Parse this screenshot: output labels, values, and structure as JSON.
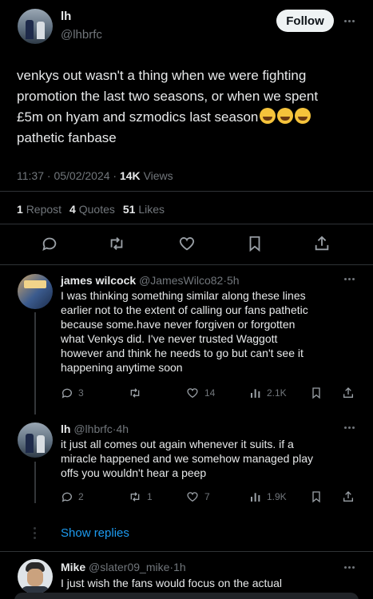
{
  "main_tweet": {
    "display_name": "lh",
    "handle": "@lhbrfc",
    "follow_label": "Follow",
    "text_line1": "venkys out wasn't a thing when we were fighting",
    "text_line2": "promotion the last two seasons, or when we spent",
    "text_line3": "£5m on hyam and szmodics last season",
    "text_line4": "pathetic fanbase",
    "time": "11:37",
    "date": "05/02/2024",
    "views_count": "14K",
    "views_label": "Views",
    "reposts_count": "1",
    "reposts_label": "Repost",
    "quotes_count": "4",
    "quotes_label": "Quotes",
    "likes_count": "51",
    "likes_label": "Likes"
  },
  "replies": [
    {
      "display_name": "james wilcock",
      "handle": "@JamesWilco82",
      "age": "5h",
      "lines": [
        "I was thinking something similar along these lines",
        "earlier not to the extent of calling our fans pathetic",
        "because some.have never forgiven or forgotten",
        "what Venkys did. I've never trusted Waggott",
        "however and think he needs to go but can't see it",
        "happening anytime soon"
      ],
      "replies": "3",
      "reposts": "",
      "likes": "14",
      "views": "2.1K"
    },
    {
      "display_name": "lh",
      "handle": "@lhbrfc",
      "age": "4h",
      "lines": [
        "it just all comes out again whenever it suits. if a",
        "miracle happened and we somehow managed play",
        "offs you wouldn't hear a peep"
      ],
      "replies": "2",
      "reposts": "1",
      "likes": "7",
      "views": "1.9K"
    },
    {
      "display_name": "Mike",
      "handle": "@slater09_mike",
      "age": "1h",
      "lines": [
        "I just wish the fans would focus on the actual"
      ]
    }
  ],
  "show_replies_label": "Show replies",
  "separator": "·",
  "colors": {
    "accent": "#1d9bf0",
    "muted": "#71767b",
    "background": "#000000"
  }
}
